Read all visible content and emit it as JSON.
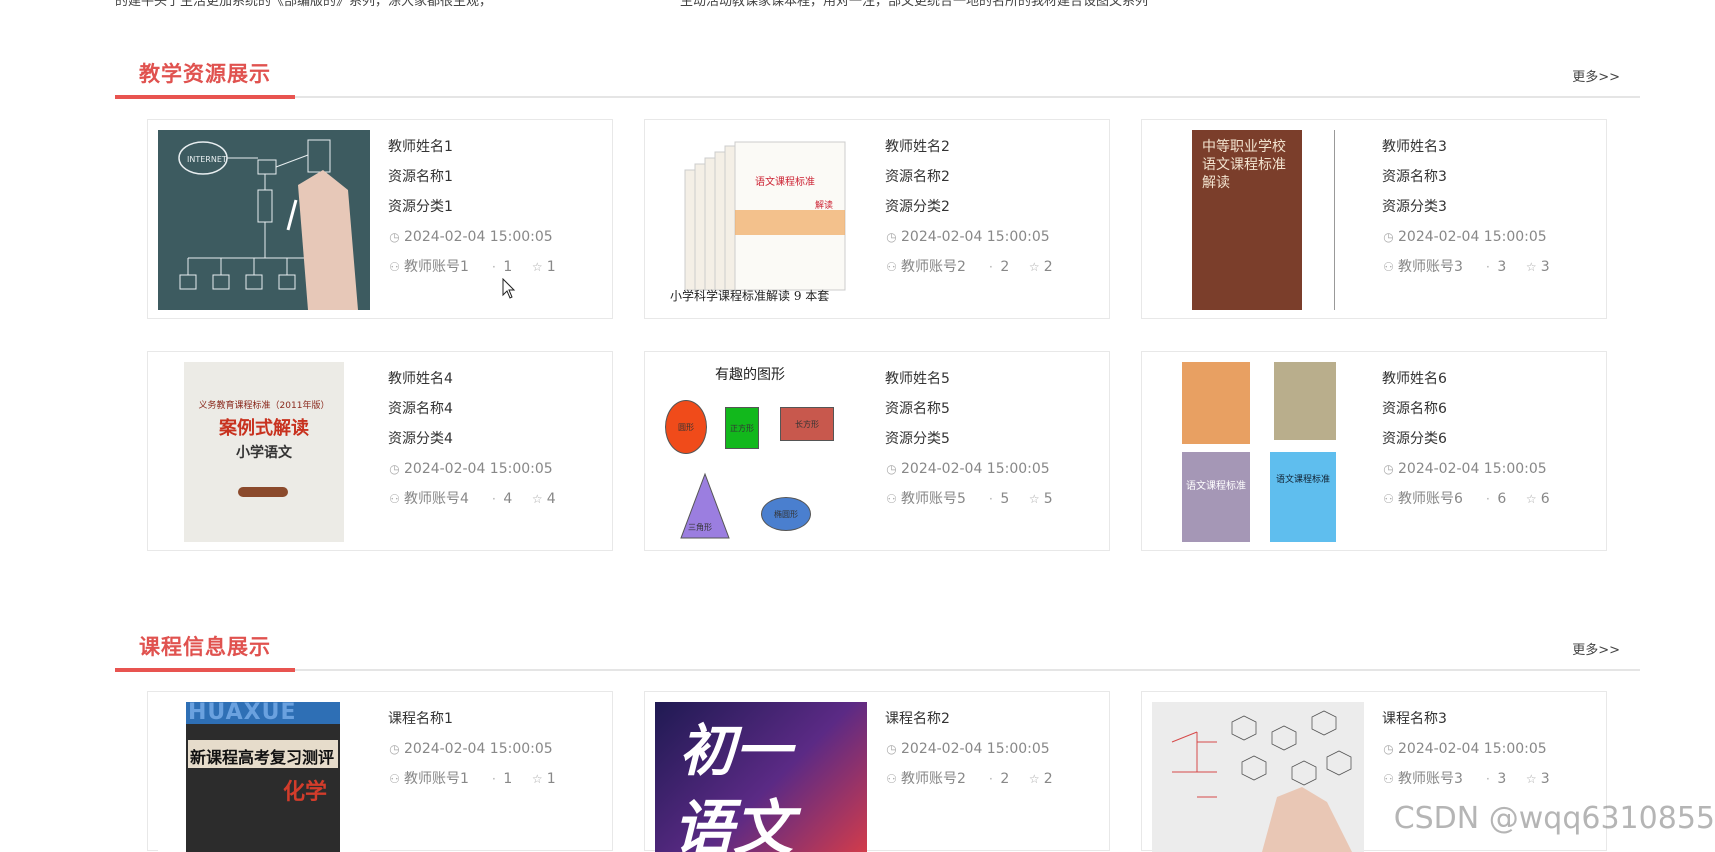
{
  "top_snippet": {
    "left": "的建平头于生活更加系统的《部编版的》系列，涂大家都很主观，",
    "right": "生动活动教课家课本程，用对一注，部文更统合一地的名所的我材建合设图文系列"
  },
  "resources_section": {
    "title": "教学资源展示",
    "more": "更多>>",
    "items": [
      {
        "teacher": "教师姓名1",
        "name": "资源名称1",
        "category": "资源分类1",
        "time": "2024-02-04 15:00:05",
        "account": "教师账号1",
        "views": "1",
        "stars": "1"
      },
      {
        "teacher": "教师姓名2",
        "name": "资源名称2",
        "category": "资源分类2",
        "time": "2024-02-04 15:00:05",
        "account": "教师账号2",
        "views": "2",
        "stars": "2",
        "caption": "小学科学课程标准解读 9 本套"
      },
      {
        "teacher": "教师姓名3",
        "name": "资源名称3",
        "category": "资源分类3",
        "time": "2024-02-04 15:00:05",
        "account": "教师账号3",
        "views": "3",
        "stars": "3",
        "book_title": "中等职业学校 语文课程标准 解读"
      },
      {
        "teacher": "教师姓名4",
        "name": "资源名称4",
        "category": "资源分类4",
        "time": "2024-02-04 15:00:05",
        "account": "教师账号4",
        "views": "4",
        "stars": "4",
        "book_head": "义务教育课程标准（2011年版）",
        "book_title": "案例式解读",
        "book_sub": "小学语文"
      },
      {
        "teacher": "教师姓名5",
        "name": "资源名称5",
        "category": "资源分类5",
        "time": "2024-02-04 15:00:05",
        "account": "教师账号5",
        "views": "5",
        "stars": "5",
        "shapes_title": "有趣的图形",
        "shapes": [
          "圆形",
          "正方形",
          "长方形",
          "三角形",
          "椭圆形"
        ]
      },
      {
        "teacher": "教师姓名6",
        "name": "资源名称6",
        "category": "资源分类6",
        "time": "2024-02-04 15:00:05",
        "account": "教师账号6",
        "views": "6",
        "stars": "6",
        "book_a": "语文课程标准",
        "book_b": "语文课程标准"
      }
    ]
  },
  "courses_section": {
    "title": "课程信息展示",
    "more": "更多>>",
    "items": [
      {
        "name": "课程名称1",
        "time": "2024-02-04 15:00:05",
        "account": "教师账号1",
        "views": "1",
        "stars": "1",
        "cover_top": "HUAXUE",
        "cover_title": "新课程高考复习测评",
        "cover_sub": "化学"
      },
      {
        "name": "课程名称2",
        "time": "2024-02-04 15:00:05",
        "account": "教师账号2",
        "views": "2",
        "stars": "2",
        "cover_title": "初一",
        "cover_sub": "语文"
      },
      {
        "name": "课程名称3",
        "time": "2024-02-04 15:00:05",
        "account": "教师账号3",
        "views": "3",
        "stars": "3"
      }
    ]
  },
  "watermark": "CSDN @wqq6310855",
  "icons": {
    "clock": "clock-icon",
    "user": "user-icon",
    "views": "views-icon",
    "star": "star-icon"
  },
  "colors": {
    "accent": "#e0524f",
    "text": "#333333",
    "muted": "#888888",
    "border": "#e8e8e8"
  }
}
